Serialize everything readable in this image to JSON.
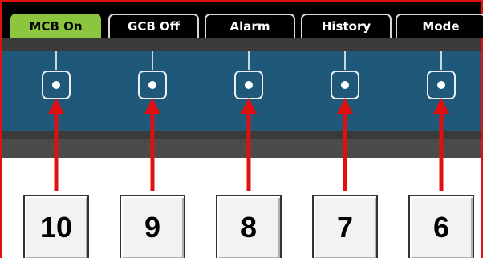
{
  "tabs": [
    {
      "label": "MCB On",
      "active": true
    },
    {
      "label": "GCB Off",
      "active": false
    },
    {
      "label": "Alarm",
      "active": false
    },
    {
      "label": "History",
      "active": false
    },
    {
      "label": "Mode",
      "active": false
    }
  ],
  "leds": [
    {
      "callout": "10"
    },
    {
      "callout": "9"
    },
    {
      "callout": "8"
    },
    {
      "callout": "7"
    },
    {
      "callout": "6"
    }
  ],
  "colors": {
    "active_tab": "#8cc63f",
    "panel": "#1f5878",
    "arrow": "#e01010",
    "frame": "#e01010"
  },
  "icons": {
    "led": "led-indicator-icon",
    "arrow": "arrow-up-icon"
  }
}
